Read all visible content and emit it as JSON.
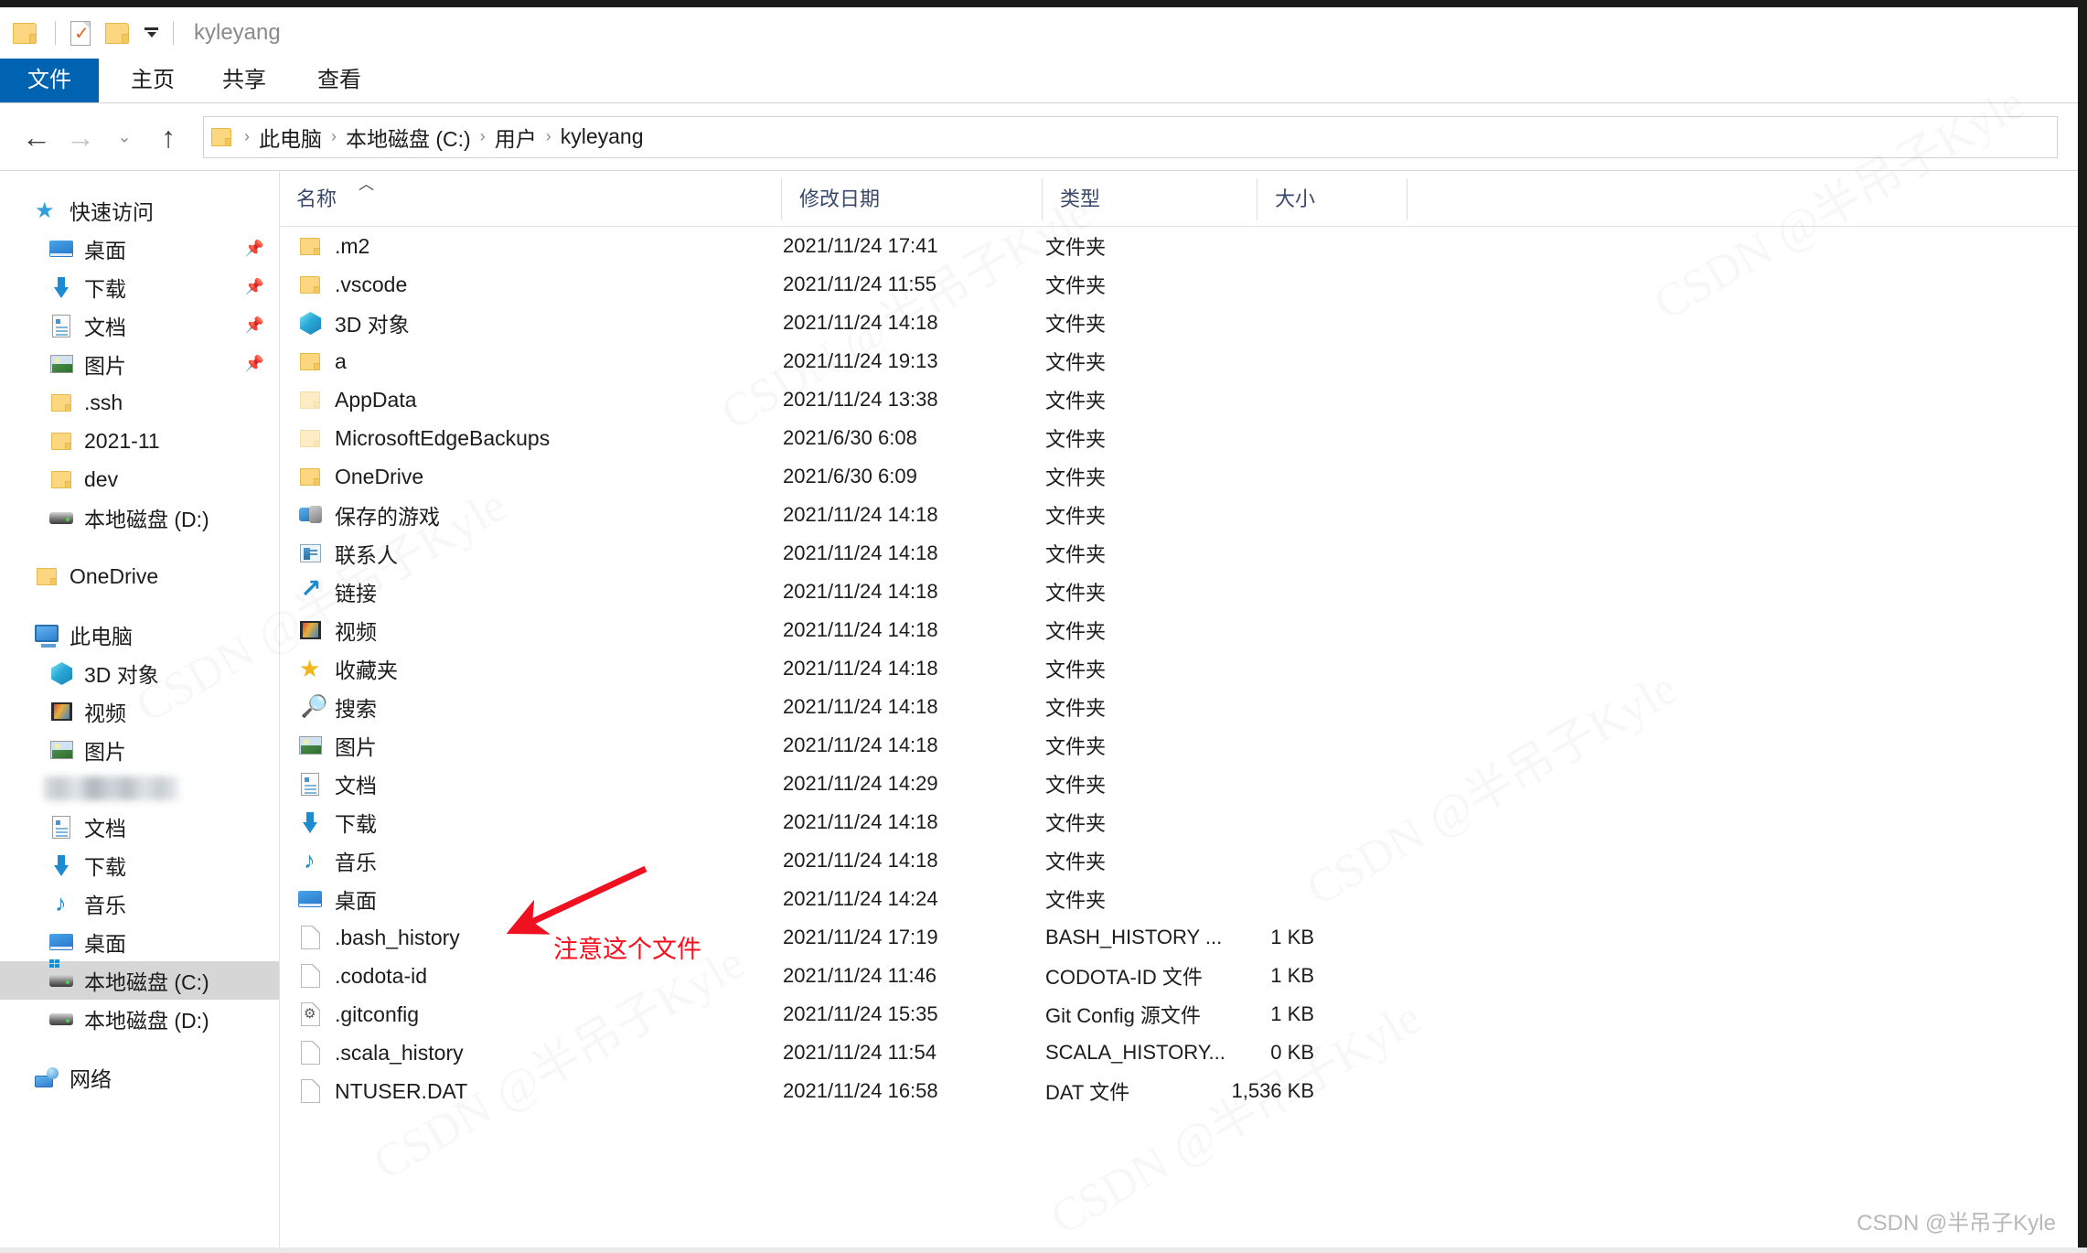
{
  "window": {
    "title": "kyleyang",
    "quick_access_toolbar": [
      {
        "icon": "folder-icon",
        "name": "qat-folder"
      },
      {
        "icon": "properties-icon",
        "name": "qat-properties"
      },
      {
        "icon": "new-folder-icon",
        "name": "qat-new-folder"
      },
      {
        "icon": "chevron-down-icon",
        "name": "qat-customize"
      }
    ]
  },
  "ribbon": {
    "tabs": [
      {
        "label": "文件",
        "active": true
      },
      {
        "label": "主页",
        "active": false
      },
      {
        "label": "共享",
        "active": false
      },
      {
        "label": "查看",
        "active": false
      }
    ]
  },
  "navigation": {
    "back_icon": "arrow-left-icon",
    "forward_icon": "arrow-right-icon",
    "recent_icon": "chevron-down-icon",
    "up_icon": "arrow-up-icon",
    "breadcrumb": [
      "此电脑",
      "本地磁盘 (C:)",
      "用户",
      "kyleyang"
    ],
    "separator": "›"
  },
  "sidebar": {
    "groups": [
      {
        "name": "quick-access",
        "header": {
          "label": "快速访问",
          "icon": "star-pin-icon"
        },
        "items": [
          {
            "label": "桌面",
            "icon": "desktop-icon",
            "pinned": true
          },
          {
            "label": "下载",
            "icon": "download-icon",
            "pinned": true
          },
          {
            "label": "文档",
            "icon": "documents-icon",
            "pinned": true
          },
          {
            "label": "图片",
            "icon": "pictures-icon",
            "pinned": true
          },
          {
            "label": ".ssh",
            "icon": "folder-icon",
            "pinned": false
          },
          {
            "label": "2021-11",
            "icon": "folder-icon",
            "pinned": false
          },
          {
            "label": "dev",
            "icon": "folder-icon",
            "pinned": false
          },
          {
            "label": "本地磁盘 (D:)",
            "icon": "drive-icon",
            "pinned": false
          }
        ]
      },
      {
        "name": "onedrive",
        "items": [
          {
            "label": "OneDrive",
            "icon": "folder-icon",
            "pinned": false
          }
        ]
      },
      {
        "name": "this-pc",
        "header": {
          "label": "此电脑",
          "icon": "computer-icon"
        },
        "items": [
          {
            "label": "3D 对象",
            "icon": "3d-objects-icon",
            "pinned": false
          },
          {
            "label": "视频",
            "icon": "videos-icon",
            "pinned": false
          },
          {
            "label": "图片",
            "icon": "pictures-icon",
            "pinned": false
          },
          {
            "label": "",
            "icon": "blurred-icon",
            "pinned": false,
            "blurred": true
          },
          {
            "label": "文档",
            "icon": "documents-icon",
            "pinned": false
          },
          {
            "label": "下载",
            "icon": "download-icon",
            "pinned": false
          },
          {
            "label": "音乐",
            "icon": "music-icon",
            "pinned": false
          },
          {
            "label": "桌面",
            "icon": "desktop-icon",
            "pinned": false
          },
          {
            "label": "本地磁盘 (C:)",
            "icon": "windows-drive-icon",
            "pinned": false,
            "selected": true
          },
          {
            "label": "本地磁盘 (D:)",
            "icon": "drive-icon",
            "pinned": false
          }
        ]
      },
      {
        "name": "network",
        "items": [
          {
            "label": "网络",
            "icon": "network-icon",
            "pinned": false
          }
        ]
      }
    ]
  },
  "filelist": {
    "columns": [
      {
        "key": "name",
        "label": "名称",
        "sorted": "asc",
        "sort_icon": "caret-up-icon"
      },
      {
        "key": "date",
        "label": "修改日期"
      },
      {
        "key": "type",
        "label": "类型"
      },
      {
        "key": "size",
        "label": "大小"
      }
    ],
    "rows": [
      {
        "name": ".m2",
        "icon": "folder-icon",
        "date": "2021/11/24 17:41",
        "type": "文件夹",
        "size": ""
      },
      {
        "name": ".vscode",
        "icon": "folder-icon",
        "date": "2021/11/24 11:55",
        "type": "文件夹",
        "size": ""
      },
      {
        "name": "3D 对象",
        "icon": "3d-objects-icon",
        "date": "2021/11/24 14:18",
        "type": "文件夹",
        "size": ""
      },
      {
        "name": "a",
        "icon": "folder-icon",
        "date": "2021/11/24 19:13",
        "type": "文件夹",
        "size": ""
      },
      {
        "name": "AppData",
        "icon": "folder-icon-dim",
        "date": "2021/11/24 13:38",
        "type": "文件夹",
        "size": ""
      },
      {
        "name": "MicrosoftEdgeBackups",
        "icon": "folder-icon-dim",
        "date": "2021/6/30 6:08",
        "type": "文件夹",
        "size": ""
      },
      {
        "name": "OneDrive",
        "icon": "folder-icon",
        "date": "2021/6/30 6:09",
        "type": "文件夹",
        "size": ""
      },
      {
        "name": "保存的游戏",
        "icon": "saved-games-icon",
        "date": "2021/11/24 14:18",
        "type": "文件夹",
        "size": ""
      },
      {
        "name": "联系人",
        "icon": "contacts-icon",
        "date": "2021/11/24 14:18",
        "type": "文件夹",
        "size": ""
      },
      {
        "name": "链接",
        "icon": "links-icon",
        "date": "2021/11/24 14:18",
        "type": "文件夹",
        "size": ""
      },
      {
        "name": "视频",
        "icon": "videos-icon",
        "date": "2021/11/24 14:18",
        "type": "文件夹",
        "size": ""
      },
      {
        "name": "收藏夹",
        "icon": "favorites-icon",
        "date": "2021/11/24 14:18",
        "type": "文件夹",
        "size": ""
      },
      {
        "name": "搜索",
        "icon": "search-icon",
        "date": "2021/11/24 14:18",
        "type": "文件夹",
        "size": ""
      },
      {
        "name": "图片",
        "icon": "pictures-icon",
        "date": "2021/11/24 14:18",
        "type": "文件夹",
        "size": ""
      },
      {
        "name": "文档",
        "icon": "documents-icon",
        "date": "2021/11/24 14:29",
        "type": "文件夹",
        "size": ""
      },
      {
        "name": "下载",
        "icon": "download-icon",
        "date": "2021/11/24 14:18",
        "type": "文件夹",
        "size": ""
      },
      {
        "name": "音乐",
        "icon": "music-icon",
        "date": "2021/11/24 14:18",
        "type": "文件夹",
        "size": ""
      },
      {
        "name": "桌面",
        "icon": "desktop-icon",
        "date": "2021/11/24 14:24",
        "type": "文件夹",
        "size": ""
      },
      {
        "name": ".bash_history",
        "icon": "file-icon",
        "date": "2021/11/24 17:19",
        "type": "BASH_HISTORY ...",
        "size": "1 KB"
      },
      {
        "name": ".codota-id",
        "icon": "file-icon",
        "date": "2021/11/24 11:46",
        "type": "CODOTA-ID 文件",
        "size": "1 KB"
      },
      {
        "name": ".gitconfig",
        "icon": "gear-file-icon",
        "date": "2021/11/24 15:35",
        "type": "Git Config 源文件",
        "size": "1 KB"
      },
      {
        "name": ".scala_history",
        "icon": "file-icon",
        "date": "2021/11/24 11:54",
        "type": "SCALA_HISTORY...",
        "size": "0 KB"
      },
      {
        "name": "NTUSER.DAT",
        "icon": "file-icon",
        "date": "2021/11/24 16:58",
        "type": "DAT 文件",
        "size": "1,536 KB"
      }
    ]
  },
  "annotation": {
    "text": "注意这个文件",
    "color": "#fc0d1c",
    "points_to": ".bash_history"
  },
  "watermark": {
    "corner": "CSDN @半吊子Kyle",
    "diagonal": "CSDN @半吊子Kyle"
  },
  "colors": {
    "accent": "#0063b1",
    "header_text": "#39496b",
    "selection": "#d6d6d6",
    "folder": "#fcd77f",
    "annotation": "#fc0d1c"
  }
}
